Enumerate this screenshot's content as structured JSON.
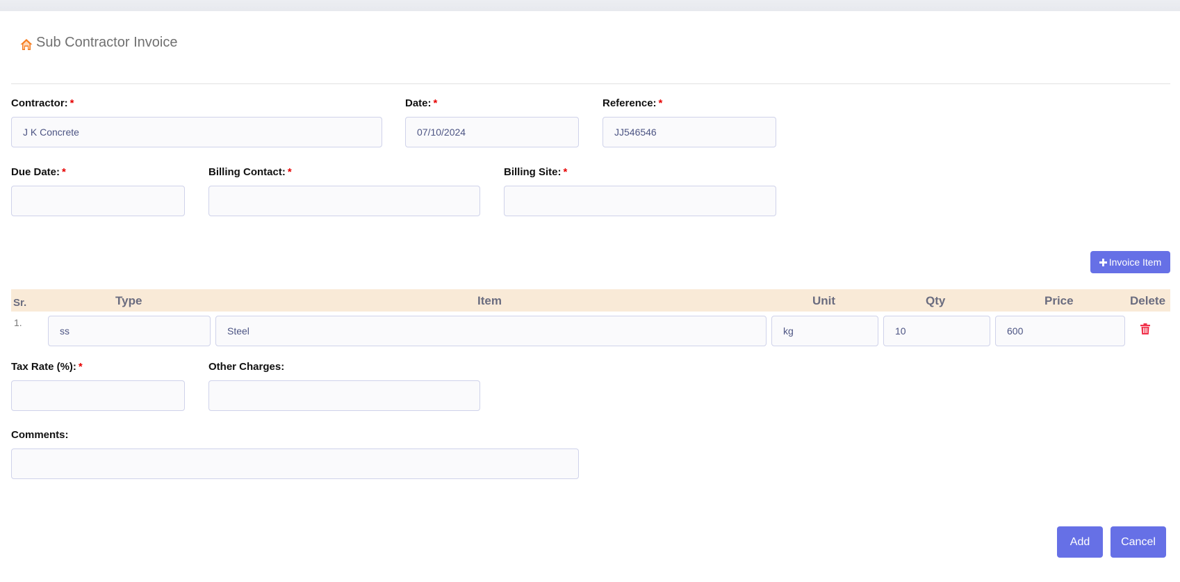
{
  "header": {
    "title": "Sub Contractor Invoice",
    "icon": "home-icon"
  },
  "form": {
    "contractor": {
      "label": "Contractor:",
      "value": "J K Concrete",
      "required": "*"
    },
    "date": {
      "label": "Date:",
      "value": "07/10/2024",
      "required": "*"
    },
    "reference": {
      "label": "Reference:",
      "value": "JJ546546",
      "required": "*"
    },
    "due_date": {
      "label": "Due Date:",
      "value": "",
      "required": "*"
    },
    "billing_contact": {
      "label": "Billing Contact:",
      "value": "",
      "required": "*"
    },
    "billing_site": {
      "label": "Billing Site:",
      "value": "",
      "required": "*"
    },
    "tax_rate": {
      "label": "Tax Rate (%):",
      "value": "",
      "required": "*"
    },
    "other_charges": {
      "label": "Other Charges:",
      "value": ""
    },
    "comments": {
      "label": "Comments:",
      "value": ""
    }
  },
  "items_table": {
    "add_button_label": "Invoice Item",
    "add_button_icon": "plus-icon",
    "columns": [
      "Sr.",
      "Type",
      "Item",
      "Unit",
      "Qty",
      "Price",
      "Delete"
    ],
    "rows": [
      {
        "sr": "1.",
        "type": "ss",
        "item": "Steel",
        "unit": "kg",
        "qty": "10",
        "price": "600",
        "delete_icon": "trash-icon"
      }
    ]
  },
  "actions": {
    "add_label": "Add",
    "cancel_label": "Cancel"
  },
  "colors": {
    "accent": "#6670e6",
    "required": "#e60000",
    "table_header_bg": "#f9ead7",
    "home_icon": "#f57c1f",
    "trash_icon": "#f0304a"
  }
}
